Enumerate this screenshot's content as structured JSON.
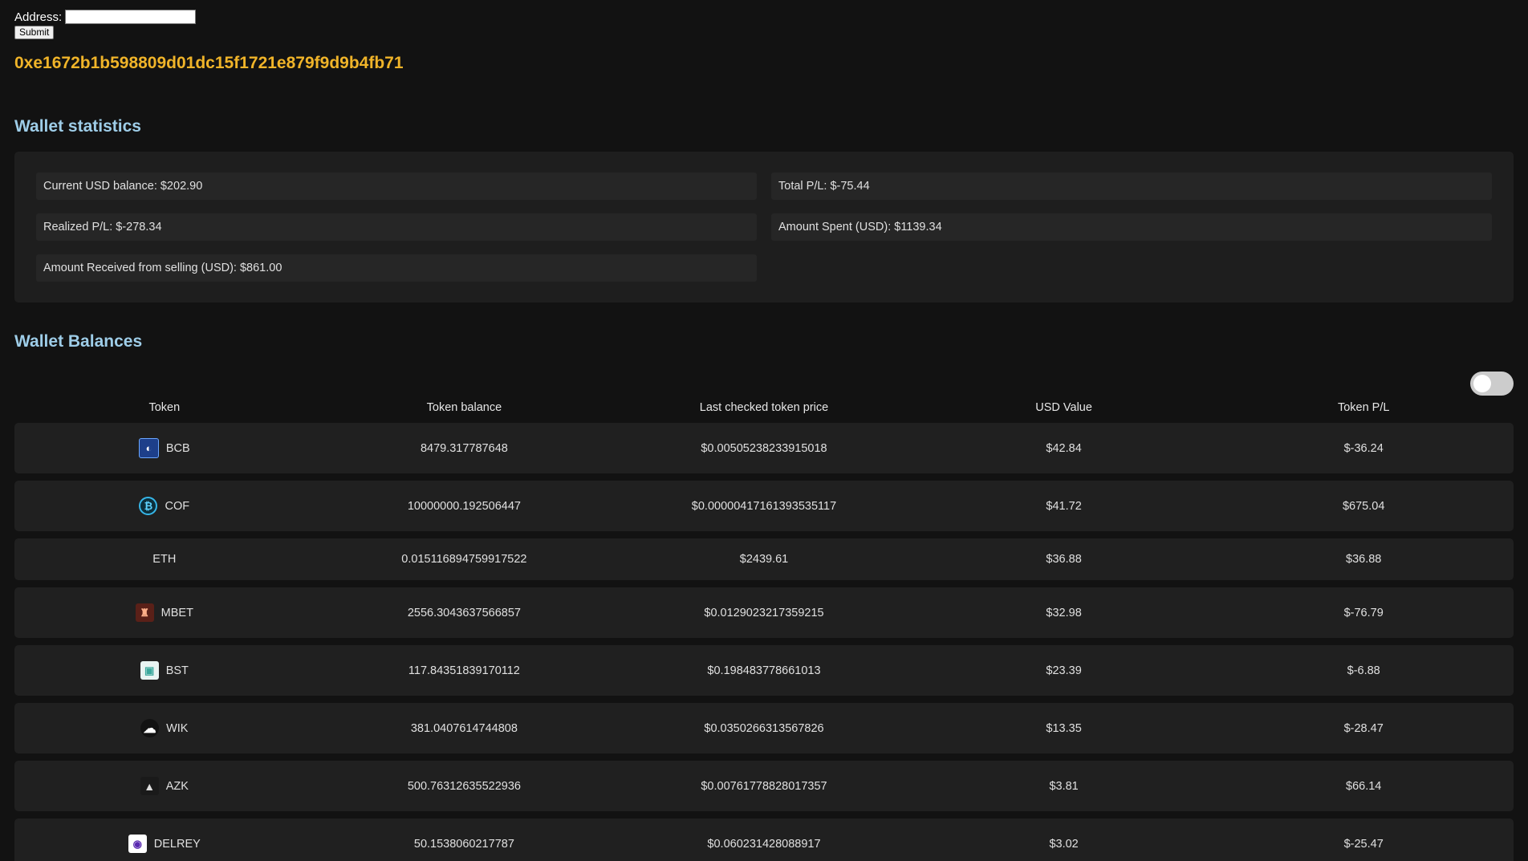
{
  "form": {
    "address_label": "Address:",
    "address_value": "",
    "submit_label": "Submit"
  },
  "wallet_address": "0xe1672b1b598809d01dc15f1721e879f9d9b4fb71",
  "stats": {
    "title": "Wallet statistics",
    "current_usd_balance": "Current USD balance: $202.90",
    "total_pl": "Total P/L: $-75.44",
    "realized_pl": "Realized P/L: $-278.34",
    "amount_spent": "Amount Spent (USD): $1139.34",
    "amount_received": "Amount Received from selling (USD): $861.00"
  },
  "balances": {
    "title": "Wallet Balances",
    "toggle_on": false,
    "headers": [
      "Token",
      "Token balance",
      "Last checked token price",
      "USD Value",
      "Token P/L"
    ],
    "rows": [
      {
        "token": "BCB",
        "icon": "bcb-icon",
        "balance": "8479.317787648",
        "price": "$0.00505238233915018",
        "usd": "$42.84",
        "pl": "$-36.24"
      },
      {
        "token": "COF",
        "icon": "cof-icon",
        "balance": "10000000.192506447",
        "price": "$0.00000417161393535117",
        "usd": "$41.72",
        "pl": "$675.04"
      },
      {
        "token": "ETH",
        "icon": "",
        "balance": "0.015116894759917522",
        "price": "$2439.61",
        "usd": "$36.88",
        "pl": "$36.88"
      },
      {
        "token": "MBET",
        "icon": "mbet-icon",
        "balance": "2556.3043637566857",
        "price": "$0.0129023217359215",
        "usd": "$32.98",
        "pl": "$-76.79"
      },
      {
        "token": "BST",
        "icon": "bst-icon",
        "balance": "117.84351839170112",
        "price": "$0.198483778661013",
        "usd": "$23.39",
        "pl": "$-6.88"
      },
      {
        "token": "WIK",
        "icon": "wik-icon",
        "balance": "381.0407614744808",
        "price": "$0.0350266313567826",
        "usd": "$13.35",
        "pl": "$-28.47"
      },
      {
        "token": "AZK",
        "icon": "azk-icon",
        "balance": "500.76312635522936",
        "price": "$0.00761778828017357",
        "usd": "$3.81",
        "pl": "$66.14"
      },
      {
        "token": "DELREY",
        "icon": "delrey-icon",
        "balance": "50.1538060217787",
        "price": "$0.060231428088917",
        "usd": "$3.02",
        "pl": "$-25.47"
      }
    ]
  }
}
